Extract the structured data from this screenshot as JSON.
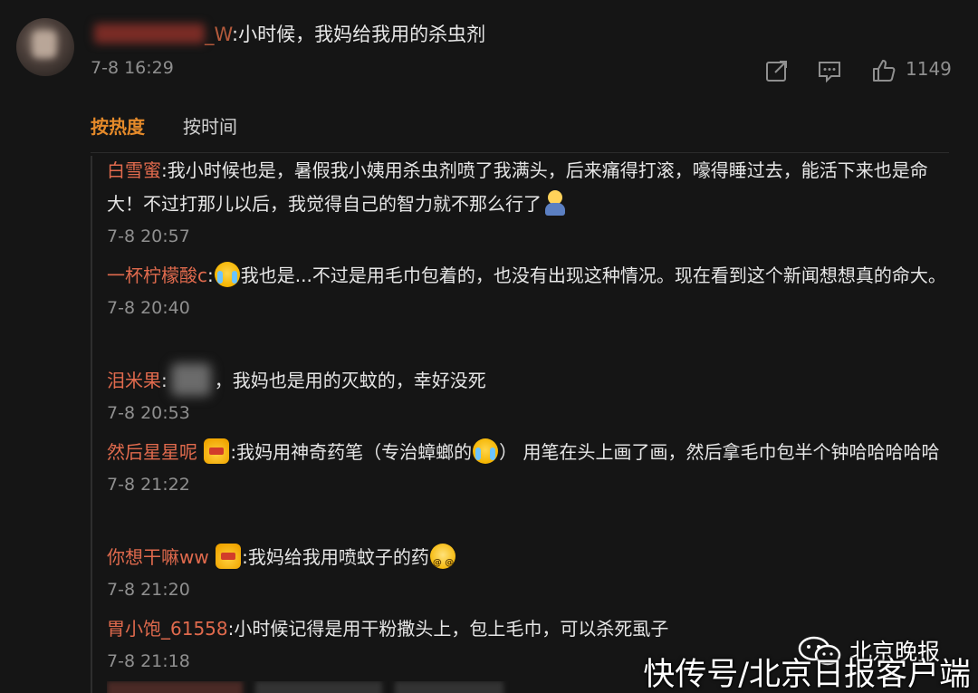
{
  "top_comment": {
    "username_tail": "_W",
    "text": ":小时候，我妈给我用的杀虫剂",
    "time": "7-8 16:29",
    "actions": {
      "share_icon": "share-icon",
      "comment_icon": "comment-icon",
      "like_icon": "thumbs-up-icon",
      "like_count": "1149"
    }
  },
  "sort_tabs": {
    "hot": "按热度",
    "time": "按时间"
  },
  "replies": [
    {
      "user": "白雪蜜",
      "text": ":我小时候也是，暑假我小姨用杀虫剂喷了我满头，后来痛得打滚，嚎得睡过去，能活下来也是命大！不过打那儿以后，我觉得自己的智力就不那么行了",
      "time": "7-8 20:57"
    },
    {
      "user": "一杯柠檬酸c",
      "text_pre": ":",
      "text": "我也是...不过是用毛巾包着的，也没有出现这种情况。现在看到这个新闻想想真的命大。",
      "time": "7-8 20:40"
    },
    {
      "user": "泪米果",
      "text_pre": ":",
      "text": "，我妈也是用的灭蚊的，幸好没死",
      "time": "7-8 20:53"
    },
    {
      "user": "然后星星呢",
      "text_a": ":我妈用神奇药笔（专治蟑螂的",
      "text_b": "） 用笔在头上画了画，然后拿毛巾包半个钟哈哈哈哈哈",
      "time": "7-8 21:22"
    },
    {
      "user": "你想干嘛ww",
      "text": ":我妈给我用喷蚊子的药",
      "time": "7-8 21:20"
    },
    {
      "user": "胃小饱_61558",
      "text": ":小时候记得是用干粉撒头上，包上毛巾，可以杀死虱子",
      "time": "7-8 21:18"
    }
  ],
  "watermarks": {
    "wechat": "北京晚报",
    "app": "快传号/北京日报客户端"
  },
  "colors": {
    "background": "#151515",
    "username": "#e06a4d",
    "active_tab": "#e58a2a",
    "time": "#8f8f8f"
  }
}
